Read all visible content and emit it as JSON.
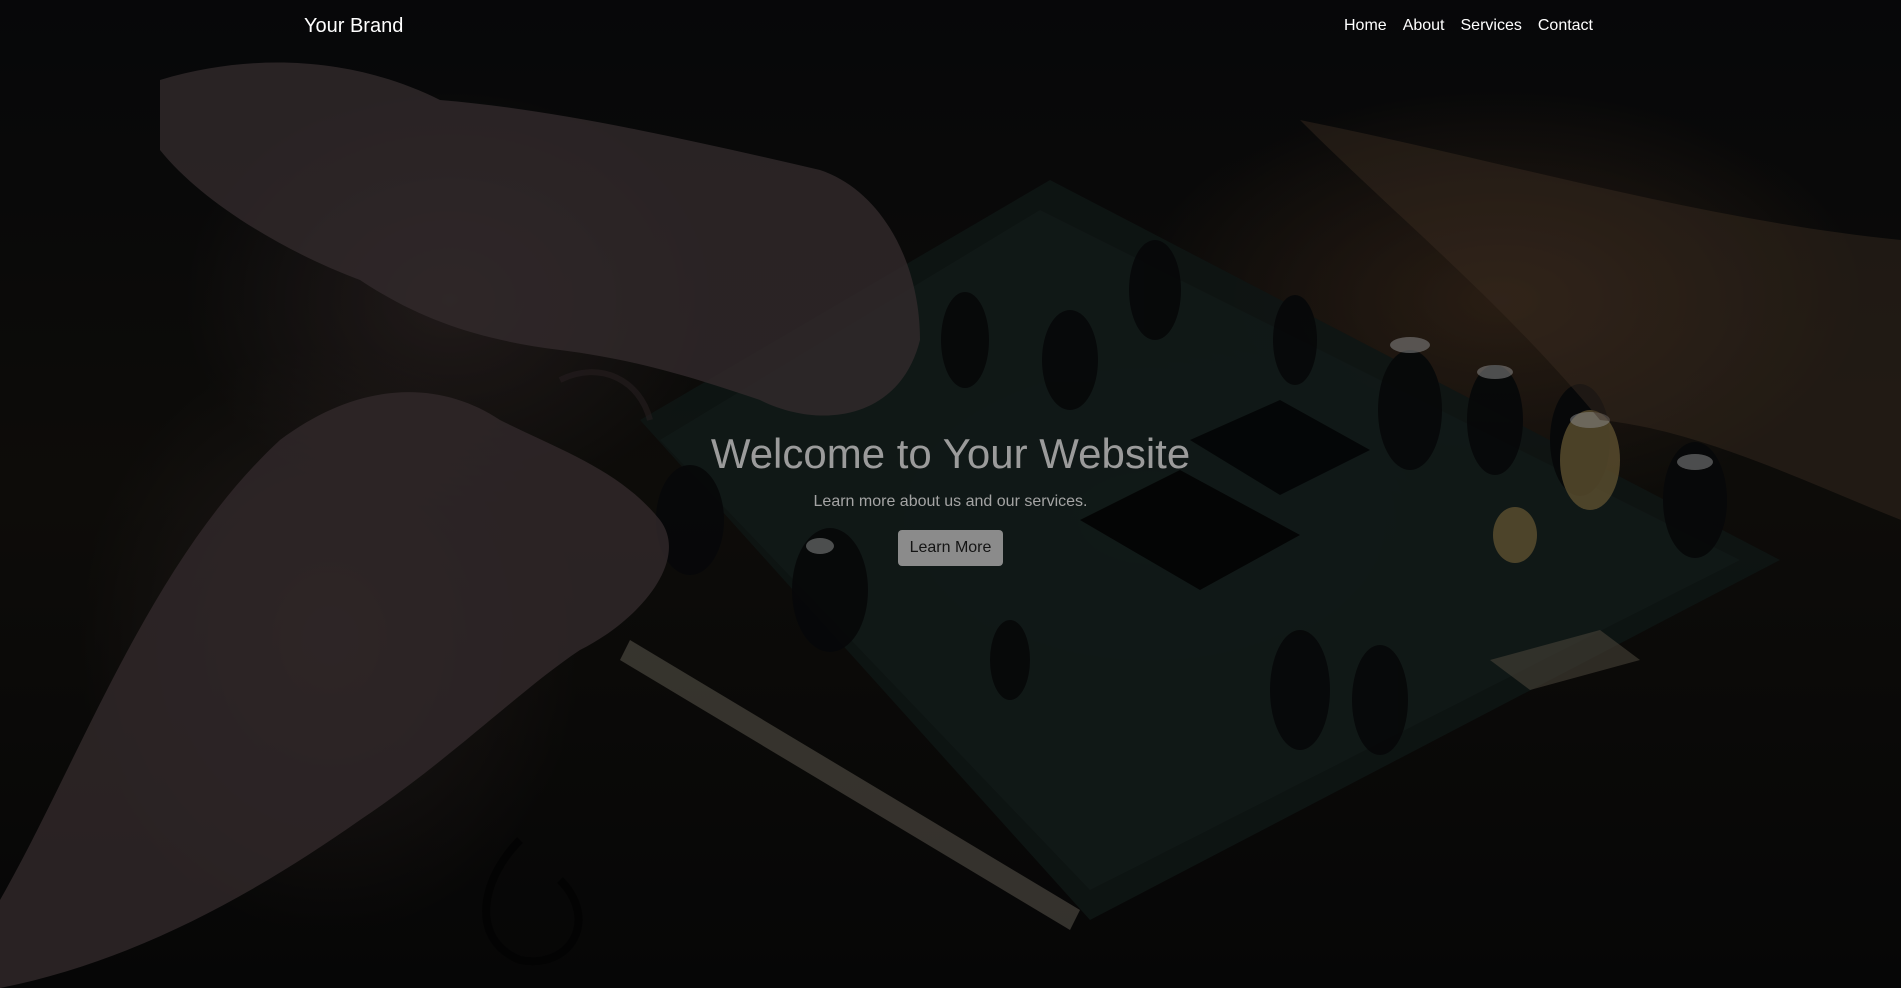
{
  "navbar": {
    "brand": "Your Brand",
    "links": [
      "Home",
      "About",
      "Services",
      "Contact"
    ]
  },
  "hero": {
    "title": "Welcome to Your Website",
    "subtitle": "Learn more about us and our services.",
    "button_label": "Learn More"
  },
  "colors": {
    "nav_text": "#ffffff",
    "title_text": "#9b9b9b",
    "button_bg": "#8b8b8b",
    "overlay": "#000000"
  }
}
